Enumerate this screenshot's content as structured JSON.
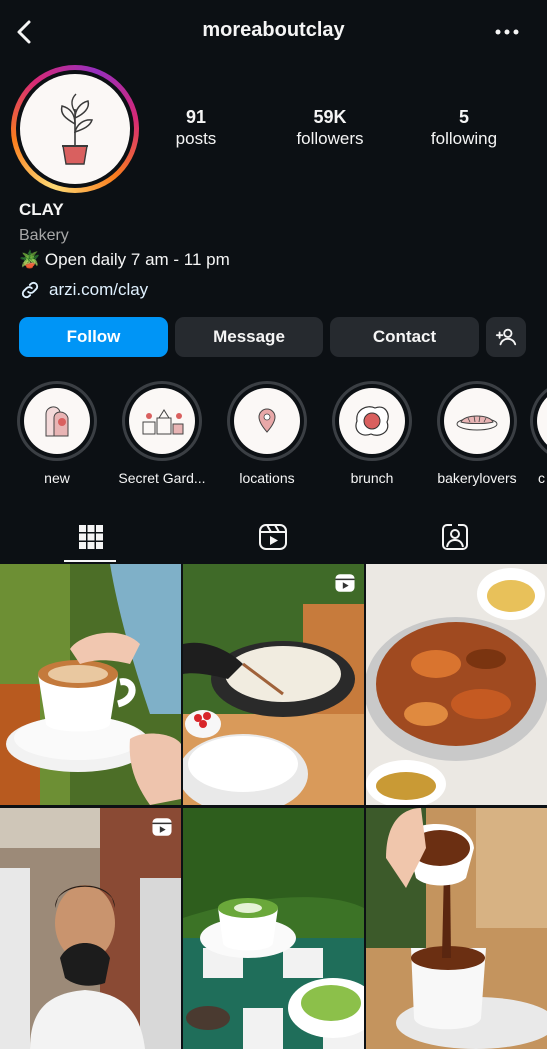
{
  "header": {
    "username": "moreaboutclay",
    "back_icon": "chevron-left-icon",
    "more_icon": "more-horizontal-icon"
  },
  "stats": [
    {
      "value": "91",
      "label": "posts"
    },
    {
      "value": "59K",
      "label": "followers"
    },
    {
      "value": "5",
      "label": "following"
    }
  ],
  "profile": {
    "name": "CLAY",
    "category": "Bakery",
    "bio": "🪴 Open daily 7 am - 11 pm",
    "link": "arzi.com/clay"
  },
  "actions": {
    "follow": "Follow",
    "message": "Message",
    "contact": "Contact",
    "add_user_icon": "add-user-icon"
  },
  "highlights": [
    {
      "label": "new",
      "icon": "clay-shapes"
    },
    {
      "label": "Secret Gard...",
      "icon": "garden-sketch"
    },
    {
      "label": "locations",
      "icon": "location-pin"
    },
    {
      "label": "brunch",
      "icon": "fried-egg"
    },
    {
      "label": "bakerylovers",
      "icon": "croissant"
    },
    {
      "label": "c",
      "icon": "partial"
    }
  ],
  "tabs": [
    {
      "name": "posts-grid",
      "icon": "grid-icon",
      "active": true
    },
    {
      "name": "reels",
      "icon": "reels-icon",
      "active": false
    },
    {
      "name": "tagged",
      "icon": "tagged-person-icon",
      "active": false
    }
  ],
  "posts": [
    {
      "subject": "caramel latte",
      "reel": false
    },
    {
      "subject": "crepe making",
      "reel": true
    },
    {
      "subject": "bread pudding tray",
      "reel": false
    },
    {
      "subject": "chef heart gesture",
      "reel": true
    },
    {
      "subject": "matcha latte and pastry",
      "reel": false
    },
    {
      "subject": "chocolate pour",
      "reel": false
    }
  ],
  "colors": {
    "background": "#0c1014",
    "follow_button": "#0095f6",
    "secondary_button": "#262a2f",
    "muted_text": "#a8a8a8",
    "link_text": "#e0f1ff"
  }
}
